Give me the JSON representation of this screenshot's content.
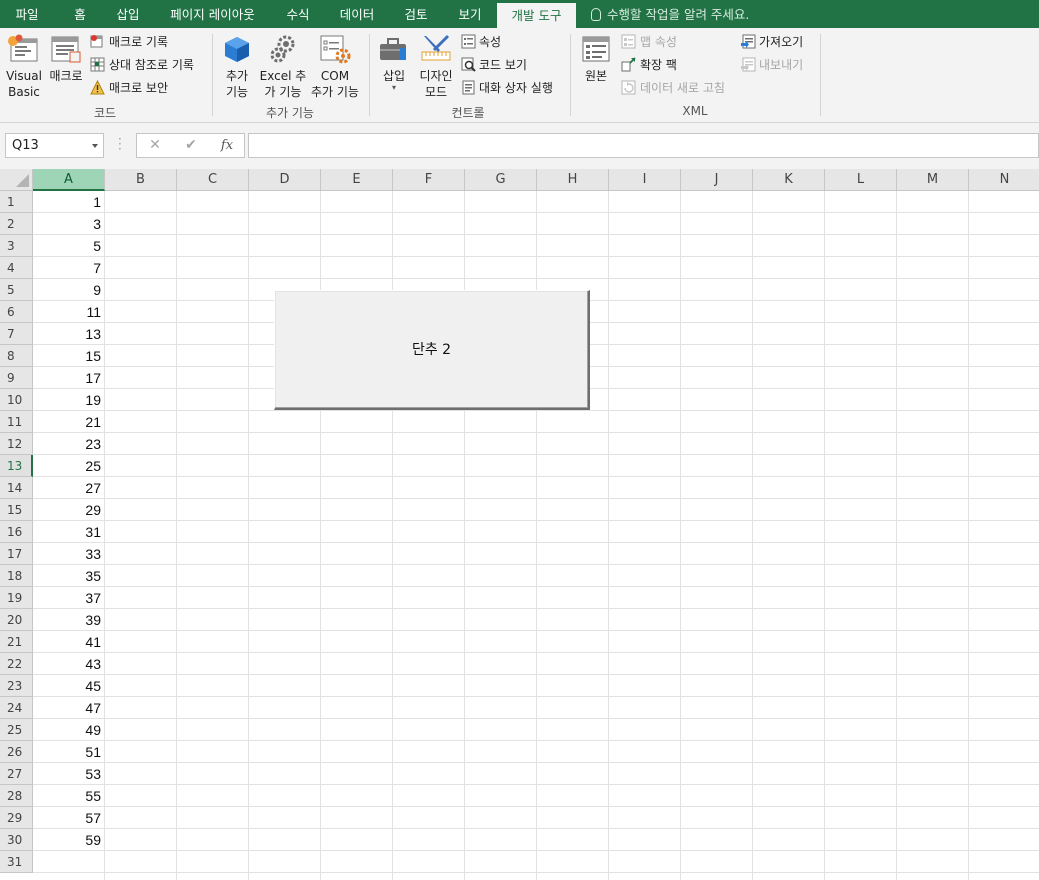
{
  "ribbon_tabs": [
    {
      "label": "파일",
      "active": false
    },
    {
      "label": "홈",
      "active": false
    },
    {
      "label": "삽입",
      "active": false
    },
    {
      "label": "페이지 레이아웃",
      "active": false
    },
    {
      "label": "수식",
      "active": false
    },
    {
      "label": "데이터",
      "active": false
    },
    {
      "label": "검토",
      "active": false
    },
    {
      "label": "보기",
      "active": false
    },
    {
      "label": "개발 도구",
      "active": true
    }
  ],
  "tell_me": "수행할 작업을 알려 주세요.",
  "groups": {
    "code": {
      "label": "코드",
      "visual_basic": [
        "Visual",
        "Basic"
      ],
      "macros": "매크로",
      "record_macro": "매크로 기록",
      "relative_refs": "상대 참조로 기록",
      "macro_security": "매크로 보안"
    },
    "addins": {
      "label": "추가 기능",
      "addins": [
        "추가",
        "기능"
      ],
      "excel_addins": [
        "Excel 추",
        "가 기능"
      ],
      "com_addins": [
        "COM",
        "추가 기능"
      ]
    },
    "controls": {
      "label": "컨트롤",
      "insert": "삽입",
      "design_mode": [
        "디자인",
        "모드"
      ],
      "properties": "속성",
      "view_code": "코드 보기",
      "run_dialog": "대화 상자 실행"
    },
    "xml": {
      "label": "XML",
      "source": "원본",
      "map_properties": "맵 속성",
      "expansion_packs": "확장 팩",
      "refresh_data": "데이터 새로 고침",
      "import": "가져오기",
      "export": "내보내기"
    }
  },
  "formula_bar": {
    "name_box": "Q13",
    "cancel": "✕",
    "enter": "✔",
    "fx": "fx",
    "formula": ""
  },
  "columns": [
    "A",
    "B",
    "C",
    "D",
    "E",
    "F",
    "G",
    "H",
    "I",
    "J",
    "K",
    "L",
    "M",
    "N"
  ],
  "selected_column": "A",
  "selected_row": 13,
  "rows": [
    1,
    2,
    3,
    4,
    5,
    6,
    7,
    8,
    9,
    10,
    11,
    12,
    13,
    14,
    15,
    16,
    17,
    18,
    19,
    20,
    21,
    22,
    23,
    24,
    25,
    26,
    27,
    28,
    29,
    30,
    31
  ],
  "column_a_values": [
    1,
    3,
    5,
    7,
    9,
    11,
    13,
    15,
    17,
    19,
    21,
    23,
    25,
    27,
    29,
    31,
    33,
    35,
    37,
    39,
    41,
    43,
    45,
    47,
    49,
    51,
    53,
    55,
    57,
    59
  ],
  "form_button": {
    "label": "단추 2"
  },
  "colors": {
    "accent": "#217346",
    "selected_header": "#9fd5b7"
  }
}
